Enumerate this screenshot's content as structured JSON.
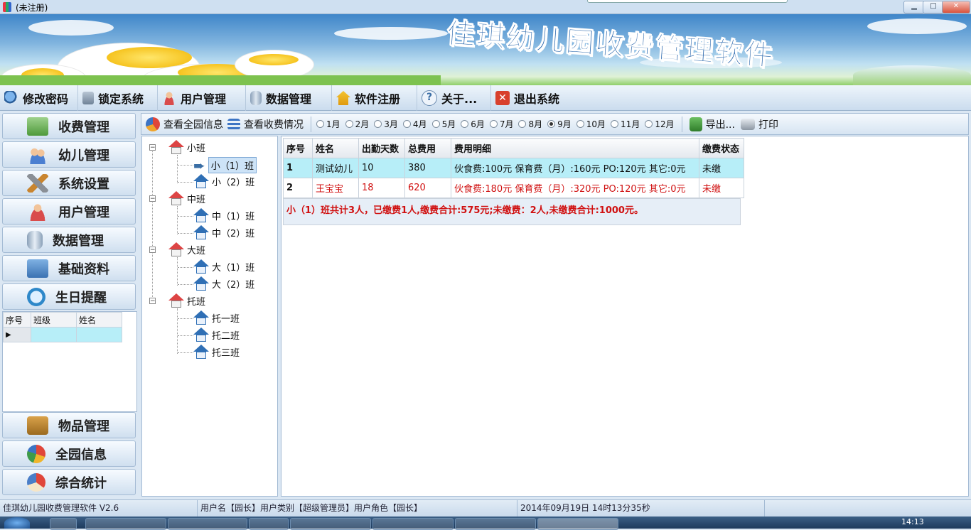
{
  "window": {
    "title": "(未注册)"
  },
  "banner": {
    "title": "佳琪幼儿园收费管理软件"
  },
  "toolbar": {
    "items": [
      {
        "label": "修改密码",
        "icon": "search-icon"
      },
      {
        "label": "锁定系统",
        "icon": "lock-icon"
      },
      {
        "label": "用户管理",
        "icon": "user-icon"
      },
      {
        "label": "数据管理",
        "icon": "database-icon"
      },
      {
        "label": "软件注册",
        "icon": "home-icon"
      },
      {
        "label": "关于...",
        "icon": "help-icon"
      },
      {
        "label": "退出系统",
        "icon": "close-icon"
      }
    ]
  },
  "nav": {
    "items": [
      {
        "label": "收费管理",
        "icon": "money-icon"
      },
      {
        "label": "幼儿管理",
        "icon": "children-icon"
      },
      {
        "label": "系统设置",
        "icon": "tools-icon"
      },
      {
        "label": "用户管理",
        "icon": "user-icon"
      },
      {
        "label": "数据管理",
        "icon": "database-icon"
      },
      {
        "label": "基础资料",
        "icon": "clipboard-icon"
      },
      {
        "label": "生日提醒",
        "icon": "clock-icon"
      }
    ],
    "bottom": [
      {
        "label": "物品管理",
        "icon": "briefcase-icon"
      },
      {
        "label": "全园信息",
        "icon": "pie-chart-icon"
      },
      {
        "label": "综合统计",
        "icon": "chart-icon"
      }
    ]
  },
  "birthday_table": {
    "headers": [
      "序号",
      "班级",
      "姓名"
    ]
  },
  "classbar": {
    "view_all": "查看全园信息",
    "view_fees": "查看收费情况",
    "months": [
      "1月",
      "2月",
      "3月",
      "4月",
      "5月",
      "6月",
      "7月",
      "8月",
      "9月",
      "10月",
      "11月",
      "12月"
    ],
    "selected_month": "9月",
    "export": "导出...",
    "print": "打印"
  },
  "tree": {
    "groups": [
      {
        "label": "小班",
        "children": [
          "小（1）班",
          "小（2）班"
        ]
      },
      {
        "label": "中班",
        "children": [
          "中（1）班",
          "中（2）班"
        ]
      },
      {
        "label": "大班",
        "children": [
          "大（1）班",
          "大（2）班"
        ]
      },
      {
        "label": "托班",
        "children": [
          "托一班",
          "托二班",
          "托三班"
        ]
      }
    ],
    "selected": "小（1）班"
  },
  "grid": {
    "headers": [
      "序号",
      "姓名",
      "出勤天数",
      "总费用",
      "费用明细",
      "缴费状态"
    ],
    "rows": [
      [
        "1",
        "测试幼儿",
        "10",
        "380",
        "伙食费:100元 保育费（月）:160元 PO:120元 其它:0元",
        "未缴"
      ],
      [
        "2",
        "王宝宝",
        "18",
        "620",
        "伙食费:180元 保育费（月）:320元 PO:120元 其它:0元",
        "未缴"
      ]
    ],
    "summary": "小（1）班共计3人，已缴费1人,缴费合计:575元;未缴费：2人,未缴费合计:1000元。"
  },
  "statusbar": {
    "app": "佳琪幼儿园收费管理软件 V2.6",
    "user": "用户名【园长】用户类别【超级管理员】用户角色【园长】",
    "datetime": "2014年09月19日 14时13分35秒"
  },
  "taskbar": {
    "clock": "14:13"
  },
  "colors": {
    "accent": "#1f5fa8",
    "highlight_row": "#b7eef8",
    "warning_text": "#d01010"
  }
}
